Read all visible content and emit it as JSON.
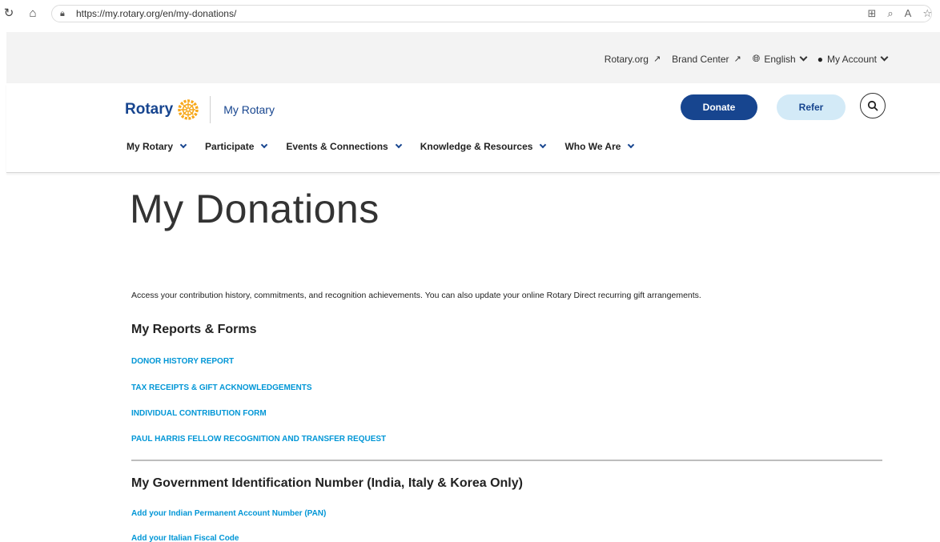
{
  "browser": {
    "url": "https://my.rotary.org/en/my-donations/"
  },
  "utility": {
    "rotary_org": "Rotary.org",
    "brand_center": "Brand Center",
    "language": "English",
    "account": "My Account"
  },
  "header": {
    "logo_word": "Rotary",
    "logo_sub": "My Rotary",
    "donate": "Donate",
    "refer": "Refer"
  },
  "nav": {
    "items": [
      {
        "label": "My Rotary"
      },
      {
        "label": "Participate"
      },
      {
        "label": "Events & Connections"
      },
      {
        "label": "Knowledge & Resources"
      },
      {
        "label": "Who We Are"
      }
    ]
  },
  "content": {
    "title": "My Donations",
    "intro": "Access your contribution history, commitments, and recognition achievements. You can also update your online Rotary Direct recurring gift arrangements.",
    "reports_heading": "My Reports & Forms",
    "report_links": [
      "DONOR HISTORY REPORT",
      "TAX RECEIPTS & GIFT ACKNOWLEDGEMENTS",
      "INDIVIDUAL CONTRIBUTION FORM",
      "PAUL HARRIS FELLOW RECOGNITION AND TRANSFER REQUEST"
    ],
    "gov_heading": "My Government Identification Number (India, Italy & Korea Only)",
    "gov_links": [
      "Add your Indian Permanent Account Number (PAN)",
      "Add your Italian Fiscal Code"
    ]
  },
  "colors": {
    "brand_blue": "#17458f",
    "link_blue": "#0096d6",
    "gold": "#f7a81b",
    "refer_bg": "#d3eaf7"
  }
}
